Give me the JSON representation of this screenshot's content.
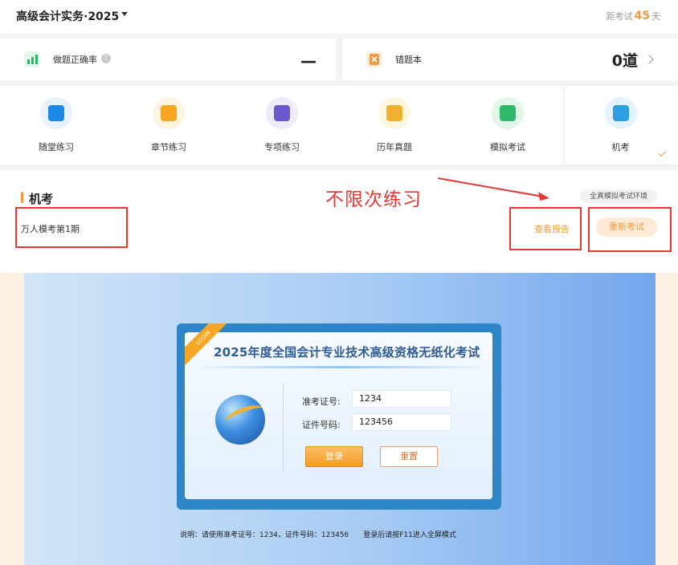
{
  "header": {
    "subject_title": "高级会计实务·2025",
    "countdown_prefix": "距考试",
    "countdown_days": "45",
    "countdown_suffix": "天"
  },
  "stats": {
    "accuracy_label": "做题正确率",
    "accuracy_info": "!",
    "accuracy_value": "—",
    "wrong_book_label": "错题本",
    "wrong_book_count": "0道"
  },
  "categories": [
    {
      "label": "随堂练习",
      "icon": "chat-bubble-icon",
      "color": "#1e88e5",
      "bg": "#e7f2fd"
    },
    {
      "label": "章节练习",
      "icon": "book-icon",
      "color": "#f5a623",
      "bg": "#fff4e0"
    },
    {
      "label": "专项练习",
      "icon": "document-list-icon",
      "color": "#6a5acd",
      "bg": "#eeebfb"
    },
    {
      "label": "历年真题",
      "icon": "exam-paper-icon",
      "color": "#f0b030",
      "bg": "#fff6dd"
    },
    {
      "label": "模拟考试",
      "icon": "monitor-icon",
      "color": "#2fb86a",
      "bg": "#e2f6ea"
    },
    {
      "label": "机考",
      "icon": "computer-exam-icon",
      "color": "#2d9ee0",
      "bg": "#e3f2fc"
    }
  ],
  "exam": {
    "section_title": "机考",
    "item_name": "万人模考第1期",
    "env_badge": "全真模拟考试环境",
    "report_label": "查看报告",
    "retest_label": "重新考试",
    "annotation": "不限次练习"
  },
  "login": {
    "ribbon": "LOGIN",
    "title": "2025年度全国会计专业技术高级资格无纸化考试",
    "ticket_label": "准考证号:",
    "ticket_value": "1234",
    "id_label": "证件号码:",
    "id_value": "123456",
    "login_button": "登录",
    "reset_button": "重置",
    "note": "说明：请使用准考证号：1234，证件号码：123456",
    "note_tip": "登录后请按F11进入全屏模式"
  },
  "colors": {
    "accent_orange": "#f29a3d",
    "annotation_red": "#e53935",
    "login_blue": "#2e86c8"
  }
}
